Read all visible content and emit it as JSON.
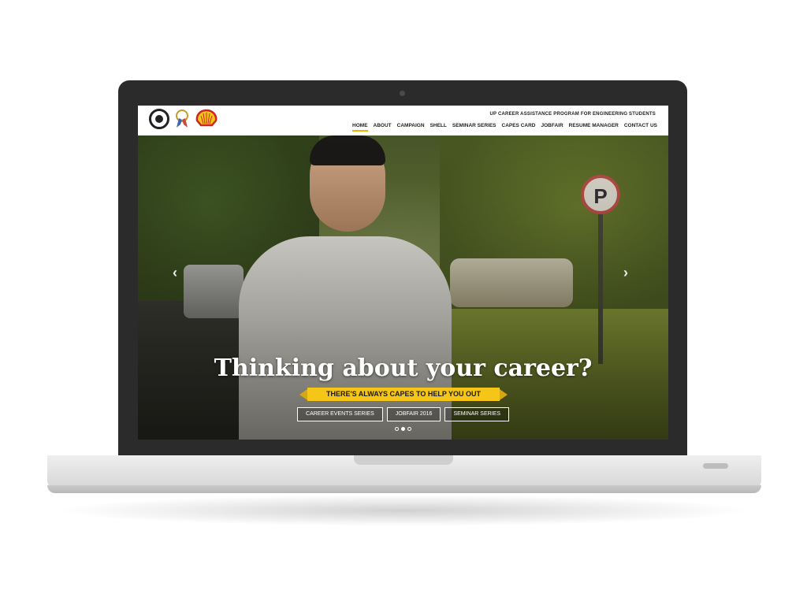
{
  "header": {
    "tagline": "UP CAREER ASSISTANCE PROGRAM FOR ENGINEERING STUDENTS",
    "logos": [
      "capes-logo-icon",
      "ribbon-badge-icon",
      "shell-logo-icon"
    ],
    "nav": [
      {
        "label": "HOME",
        "active": true
      },
      {
        "label": "ABOUT"
      },
      {
        "label": "CAMPAIGN"
      },
      {
        "label": "SHELL"
      },
      {
        "label": "SEMINAR SERIES"
      },
      {
        "label": "CAPES CARD"
      },
      {
        "label": "JOBFAIR"
      },
      {
        "label": "RESUME MANAGER"
      },
      {
        "label": "CONTACT US"
      }
    ]
  },
  "hero": {
    "headline": "Thinking about your career?",
    "ribbon": "THERE'S ALWAYS CAPES TO HELP YOU OUT",
    "sign_letter": "P",
    "buttons": [
      "CAREER EVENTS SERIES",
      "JOBFAIR 2016",
      "SEMINAR SERIES"
    ],
    "prev_icon": "‹",
    "next_icon": "›",
    "slides_total": 3,
    "active_slide": 2
  },
  "colors": {
    "accent": "#f5c518",
    "nav_underline": "#e5b800",
    "sign_border": "#c0504a"
  }
}
